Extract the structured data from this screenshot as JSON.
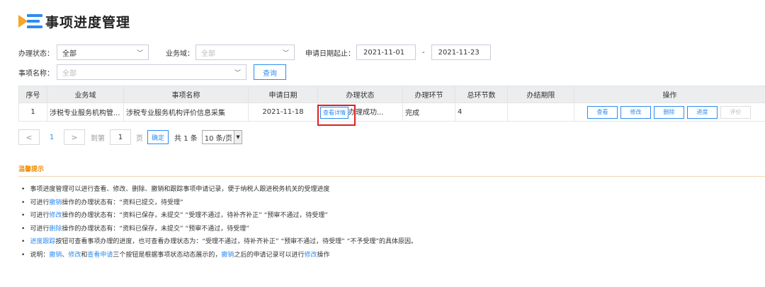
{
  "page": {
    "title": "事项进度管理"
  },
  "filters": {
    "status_label": "办理状态：",
    "status_value": "全部",
    "domain_label": "业务域：",
    "domain_value": "全部",
    "date_label": "申请日期起止：",
    "date_start": "2021-11-01",
    "date_sep": "-",
    "date_end": "2021-11-23",
    "item_label": "事项名称：",
    "item_value": "全部",
    "query_label": "查询"
  },
  "table": {
    "headers": [
      "序号",
      "业务域",
      "事项名称",
      "申请日期",
      "办理状态",
      "办理环节",
      "总环节数",
      "办结期限",
      "操作"
    ],
    "rows": [
      {
        "index": "1",
        "domain": "涉税专业服务机构管...",
        "item": "涉税专业服务机构评价信息采集",
        "date": "2021-11-18",
        "detail_label": "查看详情",
        "status": "办理成功...",
        "stage": "完成",
        "total_steps": "4",
        "deadline": "",
        "ops": [
          "查看",
          "修改",
          "删除",
          "进度",
          "评价"
        ]
      }
    ]
  },
  "pager": {
    "prev": "<",
    "current": "1",
    "next": ">",
    "goto_label": "到第",
    "page_input": "1",
    "page_unit": "页",
    "confirm": "确定",
    "total": "共 1 条",
    "page_size": "10 条/页"
  },
  "tips": {
    "title": "温馨提示",
    "lines": [
      [
        {
          "t": "事项进度管理可以进行查看、修改、删除、撤销和跟踪事项申请记录，便于纳税人跟进税务机关的受理进度"
        }
      ],
      [
        {
          "t": "可进行"
        },
        {
          "t": "撤销",
          "link": true
        },
        {
          "t": "操作的办理状态有：“资料已提交，待受理”"
        }
      ],
      [
        {
          "t": "可进行"
        },
        {
          "t": "修改",
          "link": true
        },
        {
          "t": "操作的办理状态有：“资料已保存，未提交” “受理不通过，待补齐补正” “预审不通过，待受理”"
        }
      ],
      [
        {
          "t": "可进行"
        },
        {
          "t": "删除",
          "link": true
        },
        {
          "t": "操作的办理状态有：“资料已保存，未提交” “预审不通过，待受理”"
        }
      ],
      [
        {
          "t": "进度跟踪",
          "link": true
        },
        {
          "t": "按钮可查看事项办理的进度，也可查看办理状态为：“受理不通过，待补齐补正” “预审不通过，待受理” “不予受理”的具体原因。"
        }
      ],
      [
        {
          "t": "说明："
        },
        {
          "t": "撤销",
          "link": true
        },
        {
          "t": "、"
        },
        {
          "t": "修改",
          "link": true
        },
        {
          "t": "和"
        },
        {
          "t": "查看申请",
          "link": true
        },
        {
          "t": "三个按钮是根据事项状态动态展示的，"
        },
        {
          "t": "撤销",
          "link": true
        },
        {
          "t": "之后的申请记录可以进行"
        },
        {
          "t": "修改",
          "link": true
        },
        {
          "t": "操作"
        }
      ]
    ]
  },
  "colors": {
    "accent": "#2d8cf0",
    "logo_orange": "#f5a623",
    "highlight": "#e02020",
    "tips": "#f08c00"
  }
}
